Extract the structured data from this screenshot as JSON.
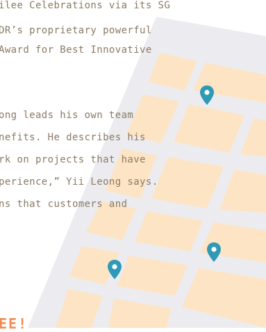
{
  "article": {
    "paragraph1": [
      "ilee Celebrations via its SG",
      "DR’s proprietary powerful",
      "Award for Best Innovative"
    ],
    "paragraph2": [
      "ong leads his own team",
      "nefits. He describes his",
      "rk on projects that have",
      "perience,” Yii Leong says.",
      "ns that customers and"
    ],
    "heading": "EE!"
  },
  "map": {
    "pin_icon": "map-pin-icon",
    "pin_color": "#2f9ab5"
  }
}
